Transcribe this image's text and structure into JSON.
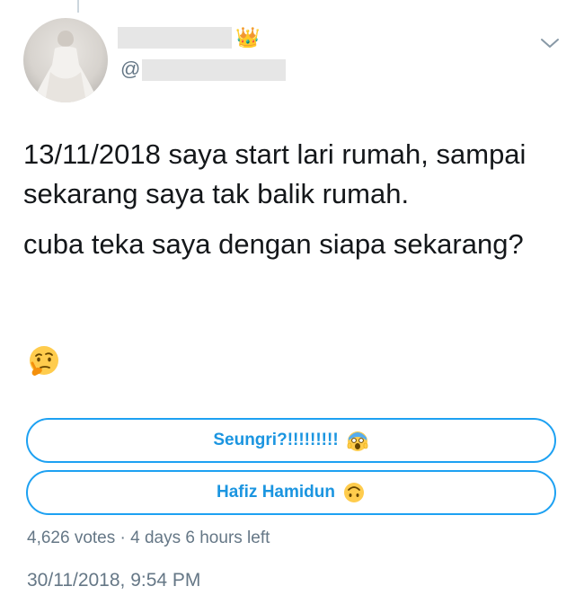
{
  "author": {
    "name_suffix_emoji": "👑",
    "handle_prefix": "@"
  },
  "icons": {
    "menu": "chevron-down-icon",
    "thinking": "thinking-face-icon",
    "screaming": "screaming-face-icon",
    "upside_down": "upside-down-face-icon"
  },
  "tweet": {
    "paragraphs": [
      "13/11/2018 saya start lari rumah, sampai sekarang saya tak balik rumah.",
      "cuba teka saya dengan siapa sekarang?"
    ]
  },
  "poll": {
    "options": [
      {
        "label": "Seungri?!!!!!!!!!"
      },
      {
        "label": "Hafiz Hamidun"
      }
    ],
    "votes": "4,626 votes",
    "separator": "·",
    "time_left": "4 days 6 hours left"
  },
  "timestamp": "30/11/2018, 9:54 PM",
  "colors": {
    "accent": "#1da1f2",
    "accent_text": "#1b95e0",
    "secondary_text": "#657786",
    "redaction": "#e6e6e6"
  }
}
